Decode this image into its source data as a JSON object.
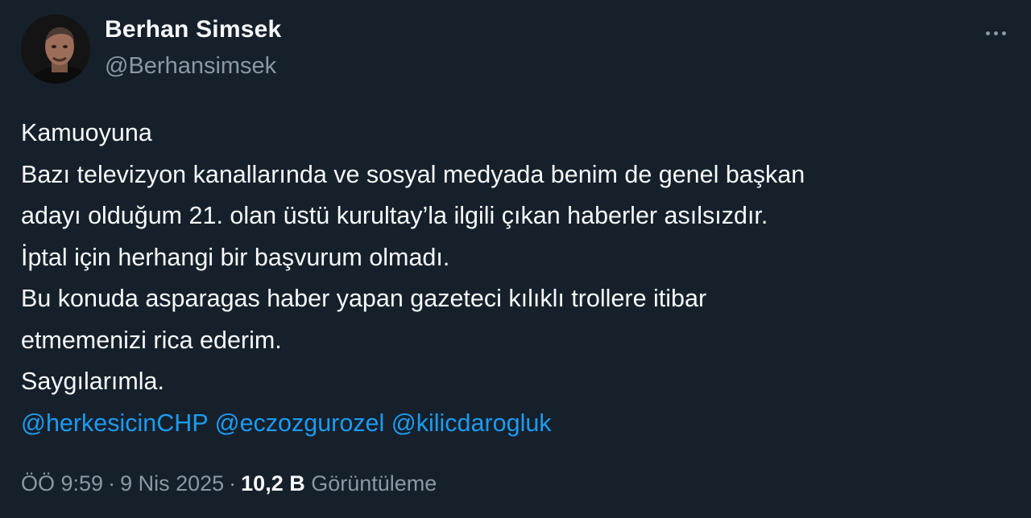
{
  "author": {
    "name": "Berhan Simsek",
    "handle": "@Berhansimsek"
  },
  "tweet": {
    "lines": [
      "Kamuoyuna",
      "Bazı televizyon kanallarında ve sosyal medyada benim de genel başkan",
      "adayı olduğum 21. olan üstü kurultay’la ilgili çıkan haberler asılsızdır.",
      "İptal için herhangi bir başvurum olmadı.",
      "Bu konuda asparagas haber yapan gazeteci kılıklı trollere itibar",
      "etmemenizi rica ederim.",
      "Saygılarımla."
    ],
    "mentions": [
      "@herkesicinCHP",
      "@eczozgurozel",
      "@kilicdarogluk"
    ]
  },
  "meta": {
    "time": "ÖÖ 9:59",
    "date": "9 Nis 2025",
    "separator": "·",
    "views_count": "10,2 B",
    "views_label": "Görüntüleme"
  },
  "colors": {
    "background": "#15202b",
    "text": "#f7f9f9",
    "secondary": "#8b98a5",
    "link": "#1d9bf0"
  },
  "icons": {
    "more": "more-horizontal-icon"
  }
}
